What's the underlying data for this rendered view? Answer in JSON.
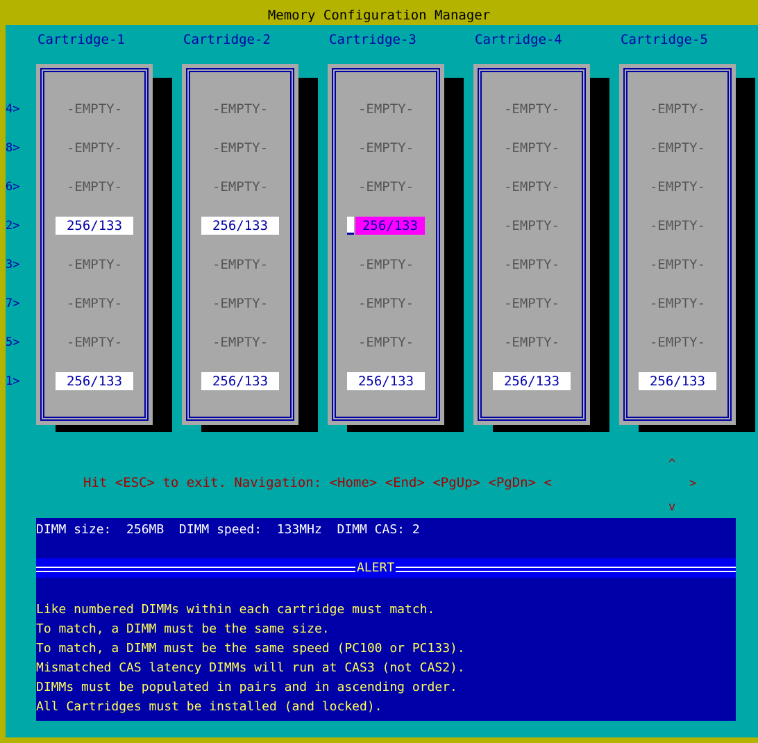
{
  "title": "Memory Configuration Manager",
  "row_labels": [
    "4>",
    "8>",
    "6>",
    "2>",
    "3>",
    "7>",
    "5>",
    "1>"
  ],
  "cartridges": [
    {
      "name": "Cartridge-1",
      "slots": [
        "-EMPTY-",
        "-EMPTY-",
        "-EMPTY-",
        "256/133",
        "-EMPTY-",
        "-EMPTY-",
        "-EMPTY-",
        "256/133"
      ]
    },
    {
      "name": "Cartridge-2",
      "slots": [
        "-EMPTY-",
        "-EMPTY-",
        "-EMPTY-",
        "256/133",
        "-EMPTY-",
        "-EMPTY-",
        "-EMPTY-",
        "256/133"
      ]
    },
    {
      "name": "Cartridge-3",
      "slots": [
        "-EMPTY-",
        "-EMPTY-",
        "-EMPTY-",
        "256/133",
        "-EMPTY-",
        "-EMPTY-",
        "-EMPTY-",
        "256/133"
      ]
    },
    {
      "name": "Cartridge-4",
      "slots": [
        "-EMPTY-",
        "-EMPTY-",
        "-EMPTY-",
        "-EMPTY-",
        "-EMPTY-",
        "-EMPTY-",
        "-EMPTY-",
        "256/133"
      ]
    },
    {
      "name": "Cartridge-5",
      "slots": [
        "-EMPTY-",
        "-EMPTY-",
        "-EMPTY-",
        "-EMPTY-",
        "-EMPTY-",
        "-EMPTY-",
        "-EMPTY-",
        "256/133"
      ]
    }
  ],
  "selected": {
    "cartridge": 3,
    "row_label": "2>"
  },
  "navigation": {
    "text": "Hit <ESC> to exit. Navigation: <Home> <End> <PgUp> <PgDn> <",
    "right_arrow": ">",
    "up_arrow": "^",
    "down_arrow": "v"
  },
  "dimm_info": "DIMM size:  256MB  DIMM speed:  133MHz  DIMM CAS: 2",
  "alert": {
    "title": "ALERT",
    "lines": [
      "Like numbered DIMMs within each cartridge must match.",
      "To match, a DIMM must be the same size.",
      "To match, a DIMM must be the same speed (PC100 or PC133).",
      "Mismatched CAS latency DIMMs will run at CAS3 (not CAS2).",
      "DIMMs must be populated in pairs and in ascending order.",
      "All Cartridges must be installed (and locked)."
    ]
  },
  "colors": {
    "background": "#b4b400",
    "panel": "#00a8a8",
    "cartridge": "#a8a8a8",
    "selected_slot": "#ff00ff",
    "info_bg": "#0000a8",
    "alert_text": "#ffff54",
    "nav_text": "#a80000"
  }
}
